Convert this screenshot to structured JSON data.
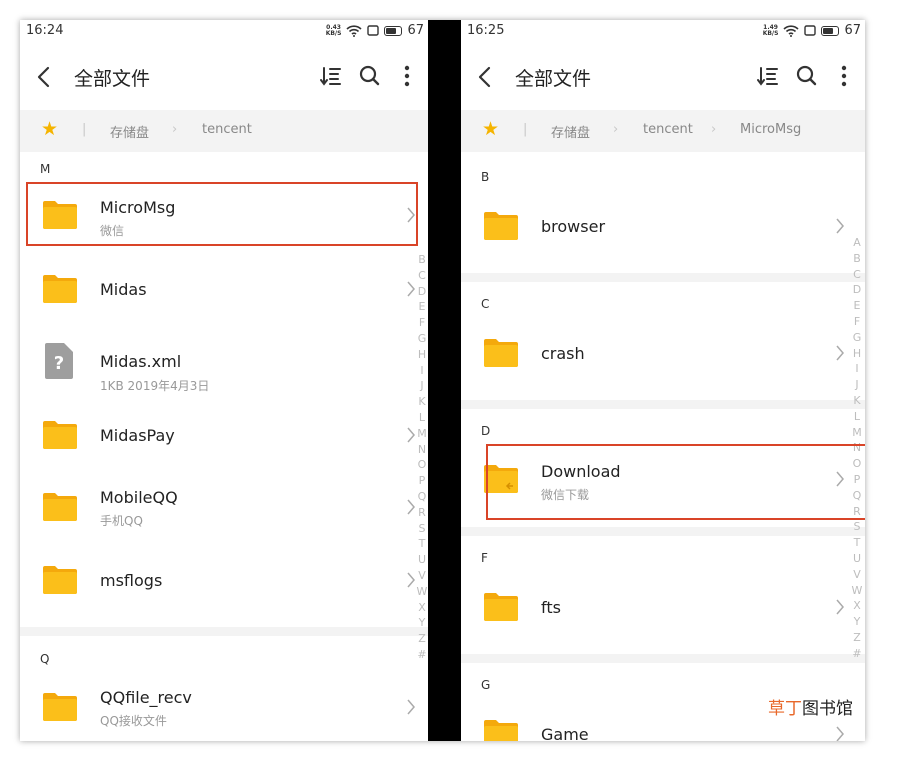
{
  "left": {
    "status": {
      "time": "16:24",
      "speed_value": "0.43",
      "speed_unit": "KB/S",
      "battery": "67"
    },
    "header": {
      "title": "全部文件"
    },
    "breadcrumb": [
      "存储盘",
      "tencent"
    ],
    "sections": {
      "m": "M",
      "q": "Q"
    },
    "items": [
      {
        "name": "MicroMsg",
        "sub": "微信"
      },
      {
        "name": "Midas",
        "sub": ""
      },
      {
        "name": "Midas.xml",
        "sub": "1KB  2019年4月3日"
      },
      {
        "name": "MidasPay",
        "sub": ""
      },
      {
        "name": "MobileQQ",
        "sub": "手机QQ"
      },
      {
        "name": "msflogs",
        "sub": ""
      },
      {
        "name": "QQfile_recv",
        "sub": "QQ接收文件"
      }
    ],
    "index": [
      "B",
      "C",
      "D",
      "E",
      "F",
      "G",
      "H",
      "I",
      "J",
      "K",
      "L",
      "M",
      "N",
      "O",
      "P",
      "Q",
      "R",
      "S",
      "T",
      "U",
      "V",
      "W",
      "X",
      "Y",
      "Z",
      "#"
    ]
  },
  "right": {
    "status": {
      "time": "16:25",
      "speed_value": "1.49",
      "speed_unit": "KB/S",
      "battery": "67"
    },
    "header": {
      "title": "全部文件"
    },
    "breadcrumb": [
      "存储盘",
      "tencent",
      "MicroMsg"
    ],
    "sections": {
      "b": "B",
      "c": "C",
      "d": "D",
      "f": "F",
      "g": "G"
    },
    "items": [
      {
        "name": "browser",
        "sub": ""
      },
      {
        "name": "crash",
        "sub": ""
      },
      {
        "name": "Download",
        "sub": "微信下载"
      },
      {
        "name": "fts",
        "sub": ""
      },
      {
        "name": "Game",
        "sub": ""
      }
    ],
    "index": [
      "A",
      "B",
      "C",
      "D",
      "E",
      "F",
      "G",
      "H",
      "I",
      "J",
      "K",
      "L",
      "M",
      "N",
      "O",
      "P",
      "Q",
      "R",
      "S",
      "T",
      "U",
      "V",
      "W",
      "X",
      "Y",
      "Z",
      "#"
    ]
  },
  "watermark": {
    "part1": "草丁",
    "part2": "图书馆"
  },
  "colors": {
    "folder": "#fbbf1a",
    "folder_back": "#f4a90c",
    "highlight": "#d94428",
    "star": "#f5b400",
    "index": "#bdbdbd"
  },
  "icons": {
    "back": "back-arrow-icon",
    "sort": "sort-icon",
    "search": "search-icon",
    "more": "more-vertical-icon",
    "star": "star-icon",
    "folder": "folder-icon",
    "file": "unknown-file-icon",
    "chevron": "chevron-right-icon"
  }
}
